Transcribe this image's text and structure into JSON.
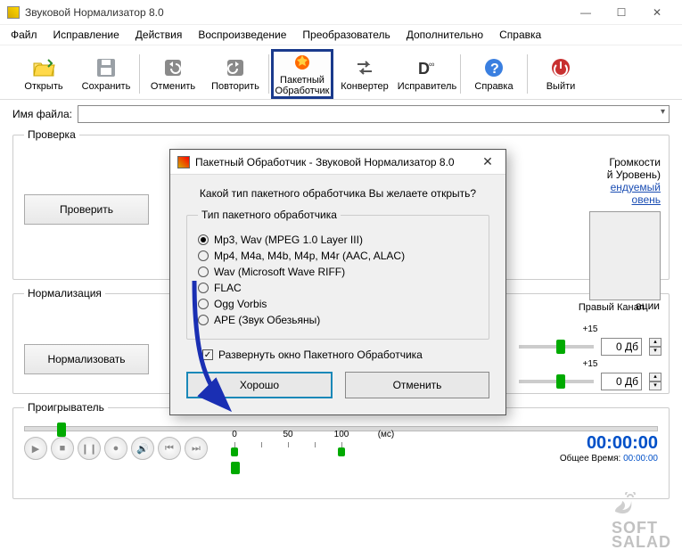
{
  "window": {
    "title": "Звуковой Нормализатор 8.0"
  },
  "menu": [
    "Файл",
    "Исправление",
    "Действия",
    "Воспроизведение",
    "Преобразователь",
    "Дополнительно",
    "Справка"
  ],
  "toolbar": {
    "open": "Открыть",
    "save": "Сохранить",
    "undo": "Отменить",
    "redo": "Повторить",
    "batch": {
      "l1": "Пакетный",
      "l2": "Обработчик"
    },
    "converter": "Конвертер",
    "fixer": "Исправитель",
    "help": "Справка",
    "exit": "Выйти"
  },
  "filename_label": "Имя файла:",
  "checkGroup": {
    "legend": "Проверка",
    "btn": "Проверить"
  },
  "rightPanel": {
    "loudness": "Громкости",
    "level": "й Уровень)",
    "recommended1": "ендуемый",
    "recommended2": "овень",
    "right_channel": "Правый Канал"
  },
  "normGroup": {
    "legend": "Нормализация",
    "btn": "Нормализовать",
    "section": "ации",
    "tick": "+15",
    "db": "0 Дб"
  },
  "playerGroup": {
    "legend": "Проигрыватель",
    "ticks": [
      "0",
      "50",
      "100"
    ],
    "unit": "(мс)",
    "time": "00:00:00",
    "total_label": "Общее Время:",
    "total": "00:00:00"
  },
  "dialog": {
    "title": "Пакетный Обработчик - Звуковой Нормализатор 8.0",
    "prompt": "Какой тип пакетного обработчика Вы желаете открыть?",
    "group_legend": "Тип пакетного обработчика",
    "options": [
      "Mp3, Wav (MPEG 1.0 Layer III)",
      "Mp4, M4a, M4b, M4p, M4r (AAC, ALAC)",
      "Wav (Microsoft Wave RIFF)",
      "FLAC",
      "Ogg Vorbis",
      "APE (Звук Обезьяны)"
    ],
    "expand": "Развернуть окно Пакетного Обработчика",
    "ok": "Хорошо",
    "cancel": "Отменить"
  },
  "watermark": {
    "l1": "SOFT",
    "l2": "SALAD"
  }
}
